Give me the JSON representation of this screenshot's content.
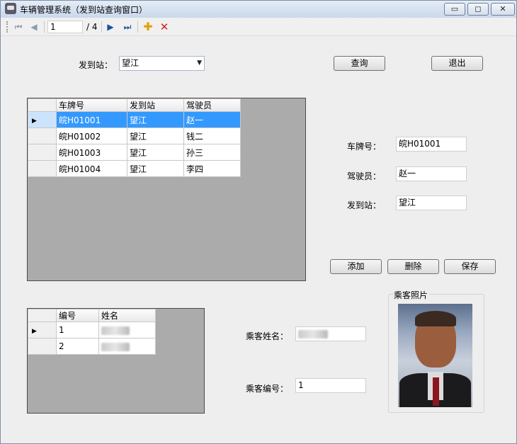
{
  "window": {
    "title": "车辆管理系统（发到站查询窗口）",
    "controls": {
      "minimize": "▭",
      "maximize": "◻",
      "close": "✕"
    }
  },
  "navigator": {
    "position": "1",
    "total": "/ 4",
    "icons": {
      "first": "⏮",
      "prev": "◀",
      "next": "▶",
      "last": "⏭",
      "add": "✚",
      "delete": "✕"
    }
  },
  "query": {
    "station_label": "发到站：",
    "station_value": "望江",
    "query_button": "查询",
    "exit_button": "退出"
  },
  "vehicles_grid": {
    "columns": [
      "车牌号",
      "发到站",
      "驾驶员"
    ],
    "rows": [
      [
        "皖H01001",
        "望江",
        "赵一"
      ],
      [
        "皖H01002",
        "望江",
        "钱二"
      ],
      [
        "皖H01003",
        "望江",
        "孙三"
      ],
      [
        "皖H01004",
        "望江",
        "李四"
      ]
    ],
    "selected_row": 0
  },
  "details": {
    "plate_label": "车牌号：",
    "plate_value": "皖H01001",
    "driver_label": "驾驶员：",
    "driver_value": "赵一",
    "station_label": "发到站：",
    "station_value": "望江"
  },
  "actions": {
    "add": "添加",
    "delete": "删除",
    "save": "保存"
  },
  "passengers_grid": {
    "columns": [
      "编号",
      "姓名"
    ],
    "rows": [
      [
        "1",
        ""
      ],
      [
        "2",
        ""
      ]
    ]
  },
  "passenger": {
    "name_label": "乘客姓名：",
    "id_label": "乘客编号：",
    "id_value": "1",
    "photo_label": "乘客照片"
  },
  "colors": {
    "selection": "#3399ff",
    "grid_background": "#ababab",
    "window_background": "#eeeeee"
  }
}
